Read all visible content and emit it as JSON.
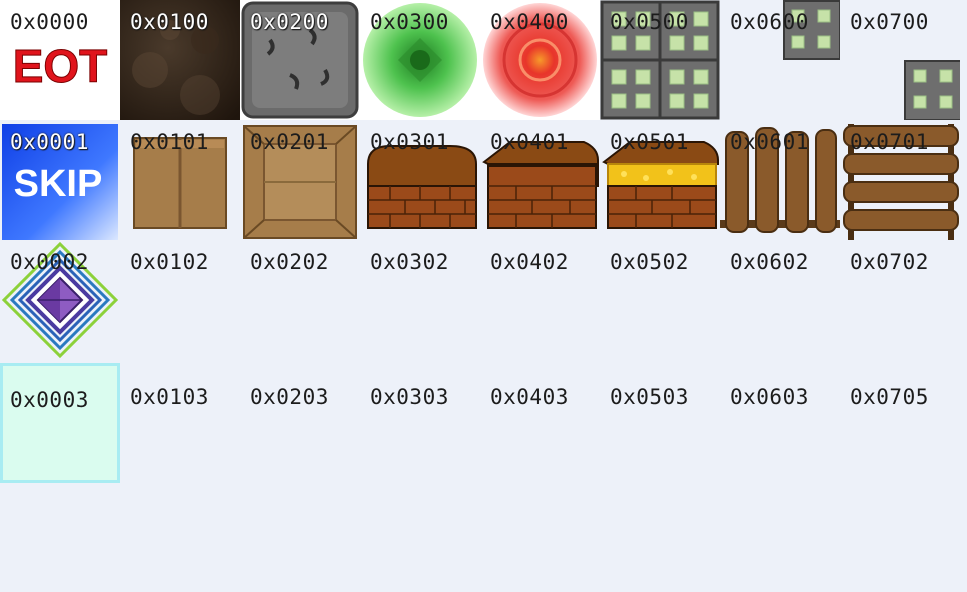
{
  "tiles": {
    "t0000": {
      "id": "0x0000",
      "text": "EOT"
    },
    "t0100": {
      "id": "0x0100"
    },
    "t0200": {
      "id": "0x0200"
    },
    "t0300": {
      "id": "0x0300"
    },
    "t0400": {
      "id": "0x0400"
    },
    "t0500": {
      "id": "0x0500"
    },
    "t0600": {
      "id": "0x0600"
    },
    "t0700": {
      "id": "0x0700"
    },
    "t0001": {
      "id": "0x0001",
      "text": "SKIP"
    },
    "t0101": {
      "id": "0x0101"
    },
    "t0201": {
      "id": "0x0201"
    },
    "t0301": {
      "id": "0x0301"
    },
    "t0401": {
      "id": "0x0401"
    },
    "t0501": {
      "id": "0x0501"
    },
    "t0601": {
      "id": "0x0601"
    },
    "t0701": {
      "id": "0x0701"
    },
    "t0002": {
      "id": "0x0002"
    },
    "t0102": {
      "id": "0x0102"
    },
    "t0202": {
      "id": "0x0202"
    },
    "t0302": {
      "id": "0x0302"
    },
    "t0402": {
      "id": "0x0402"
    },
    "t0502": {
      "id": "0x0502"
    },
    "t0602": {
      "id": "0x0602"
    },
    "t0702": {
      "id": "0x0702"
    },
    "t0003": {
      "id": "0x0003"
    },
    "t0103": {
      "id": "0x0103"
    },
    "t0203": {
      "id": "0x0203"
    },
    "t0303": {
      "id": "0x0303"
    },
    "t0403": {
      "id": "0x0403"
    },
    "t0503": {
      "id": "0x0503"
    },
    "t0603": {
      "id": "0x0603"
    },
    "t0705": {
      "id": "0x0705"
    }
  },
  "selected_tile": "0x0003",
  "colors": {
    "background": "#edf1f9",
    "eot_red": "#e0141c",
    "skip_blue": "#1a56ff",
    "selection_border": "#a8ecf2",
    "selection_fill": "#dafcef",
    "wood": "#8a5a2b",
    "brick": "#9b4a1a",
    "gold": "#f2c21a"
  },
  "icons": [
    "eot-tile-icon",
    "dirt-tile-icon",
    "stone-tile-icon",
    "green-portal-icon",
    "red-portal-icon",
    "window-block-icon",
    "small-window-icon",
    "window-block-icon",
    "skip-tile-icon",
    "cardboard-box-icon",
    "open-crate-icon",
    "closed-chest-icon",
    "open-empty-chest-icon",
    "open-gold-chest-icon",
    "vertical-fence-icon",
    "ladder-fence-icon",
    "diamond-gem-icon"
  ]
}
